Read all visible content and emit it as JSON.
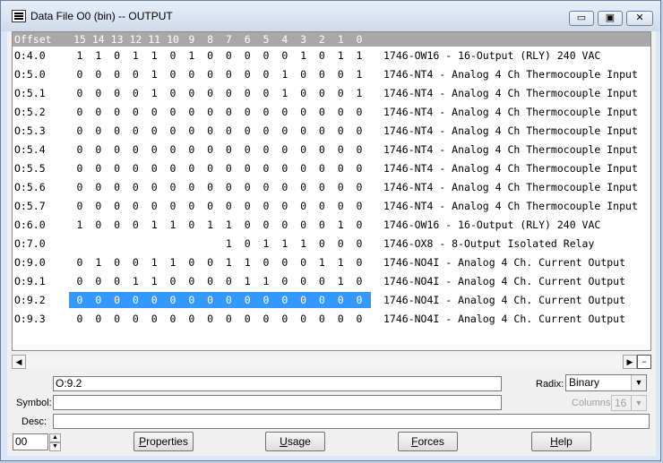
{
  "window": {
    "title": "Data File O0 (bin)  --  OUTPUT",
    "min_glyph": "▭",
    "max_glyph": "▣",
    "close_glyph": "✕"
  },
  "grid": {
    "offset_header": "Offset",
    "bit_headers": [
      "15",
      "14",
      "13",
      "12",
      "11",
      "10",
      "9",
      "8",
      "7",
      "6",
      "5",
      "4",
      "3",
      "2",
      "1",
      "0"
    ],
    "rows": [
      {
        "offset": "O:4.0",
        "bits": [
          "1",
          "1",
          "0",
          "1",
          "1",
          "0",
          "1",
          "0",
          "0",
          "0",
          "0",
          "0",
          "1",
          "0",
          "1",
          "1"
        ],
        "desc": "1746-OW16 - 16-Output (RLY) 240 VAC"
      },
      {
        "offset": "O:5.0",
        "bits": [
          "0",
          "0",
          "0",
          "0",
          "1",
          "0",
          "0",
          "0",
          "0",
          "0",
          "0",
          "1",
          "0",
          "0",
          "0",
          "1"
        ],
        "desc": "1746-NT4 - Analog 4 Ch Thermocouple Input"
      },
      {
        "offset": "O:5.1",
        "bits": [
          "0",
          "0",
          "0",
          "0",
          "1",
          "0",
          "0",
          "0",
          "0",
          "0",
          "0",
          "1",
          "0",
          "0",
          "0",
          "1"
        ],
        "desc": "1746-NT4 - Analog 4 Ch Thermocouple Input"
      },
      {
        "offset": "O:5.2",
        "bits": [
          "0",
          "0",
          "0",
          "0",
          "0",
          "0",
          "0",
          "0",
          "0",
          "0",
          "0",
          "0",
          "0",
          "0",
          "0",
          "0"
        ],
        "desc": "1746-NT4 - Analog 4 Ch Thermocouple Input"
      },
      {
        "offset": "O:5.3",
        "bits": [
          "0",
          "0",
          "0",
          "0",
          "0",
          "0",
          "0",
          "0",
          "0",
          "0",
          "0",
          "0",
          "0",
          "0",
          "0",
          "0"
        ],
        "desc": "1746-NT4 - Analog 4 Ch Thermocouple Input"
      },
      {
        "offset": "O:5.4",
        "bits": [
          "0",
          "0",
          "0",
          "0",
          "0",
          "0",
          "0",
          "0",
          "0",
          "0",
          "0",
          "0",
          "0",
          "0",
          "0",
          "0"
        ],
        "desc": "1746-NT4 - Analog 4 Ch Thermocouple Input"
      },
      {
        "offset": "O:5.5",
        "bits": [
          "0",
          "0",
          "0",
          "0",
          "0",
          "0",
          "0",
          "0",
          "0",
          "0",
          "0",
          "0",
          "0",
          "0",
          "0",
          "0"
        ],
        "desc": "1746-NT4 - Analog 4 Ch Thermocouple Input"
      },
      {
        "offset": "O:5.6",
        "bits": [
          "0",
          "0",
          "0",
          "0",
          "0",
          "0",
          "0",
          "0",
          "0",
          "0",
          "0",
          "0",
          "0",
          "0",
          "0",
          "0"
        ],
        "desc": "1746-NT4 - Analog 4 Ch Thermocouple Input"
      },
      {
        "offset": "O:5.7",
        "bits": [
          "0",
          "0",
          "0",
          "0",
          "0",
          "0",
          "0",
          "0",
          "0",
          "0",
          "0",
          "0",
          "0",
          "0",
          "0",
          "0"
        ],
        "desc": "1746-NT4 - Analog 4 Ch Thermocouple Input"
      },
      {
        "offset": "O:6.0",
        "bits": [
          "1",
          "0",
          "0",
          "0",
          "1",
          "1",
          "0",
          "1",
          "1",
          "0",
          "0",
          "0",
          "0",
          "0",
          "1",
          "0"
        ],
        "desc": "1746-OW16 - 16-Output (RLY) 240 VAC"
      },
      {
        "offset": "O:7.0",
        "bits": [
          "",
          "",
          "",
          "",
          "",
          "",
          "",
          "",
          "1",
          "0",
          "1",
          "1",
          "1",
          "0",
          "0",
          "0"
        ],
        "desc": "1746-OX8 - 8-Output Isolated Relay"
      },
      {
        "offset": "O:9.0",
        "bits": [
          "0",
          "1",
          "0",
          "0",
          "1",
          "1",
          "0",
          "0",
          "1",
          "1",
          "0",
          "0",
          "0",
          "1",
          "1",
          "0"
        ],
        "desc": "1746-NO4I - Analog 4 Ch. Current Output"
      },
      {
        "offset": "O:9.1",
        "bits": [
          "0",
          "0",
          "0",
          "1",
          "1",
          "0",
          "0",
          "0",
          "0",
          "1",
          "1",
          "0",
          "0",
          "0",
          "1",
          "0"
        ],
        "desc": "1746-NO4I - Analog 4 Ch. Current Output"
      },
      {
        "offset": "O:9.2",
        "bits": [
          "0",
          "0",
          "0",
          "0",
          "0",
          "0",
          "0",
          "0",
          "0",
          "0",
          "0",
          "0",
          "0",
          "0",
          "0",
          "0"
        ],
        "desc": "1746-NO4I - Analog 4 Ch. Current Output",
        "selected": true
      },
      {
        "offset": "O:9.3",
        "bits": [
          "0",
          "0",
          "0",
          "0",
          "0",
          "0",
          "0",
          "0",
          "0",
          "0",
          "0",
          "0",
          "0",
          "0",
          "0",
          "0"
        ],
        "desc": "1746-NO4I - Analog 4 Ch. Current Output"
      }
    ]
  },
  "scroll": {
    "left_glyph": "◀",
    "right_glyph": "▶",
    "split_glyph": "−"
  },
  "address": {
    "value": "O:9.2"
  },
  "symbol": {
    "label": "Symbol:",
    "value": ""
  },
  "desc": {
    "label": "Desc:",
    "value": ""
  },
  "radix": {
    "label": "Radix:",
    "value": "Binary",
    "arrow": "▼"
  },
  "columns": {
    "label": "Columns:",
    "value": "16",
    "arrow": "▼"
  },
  "file_number": {
    "value": "00",
    "up": "▲",
    "down": "▼"
  },
  "buttons": {
    "properties": {
      "underline": "P",
      "rest": "roperties"
    },
    "usage": {
      "underline": "U",
      "rest": "sage"
    },
    "forces": {
      "underline": "F",
      "rest": "orces"
    },
    "help": {
      "underline": "H",
      "rest": "elp"
    }
  },
  "colors": {
    "selection": "#3399ff",
    "header_bg": "#a8a8a8"
  }
}
